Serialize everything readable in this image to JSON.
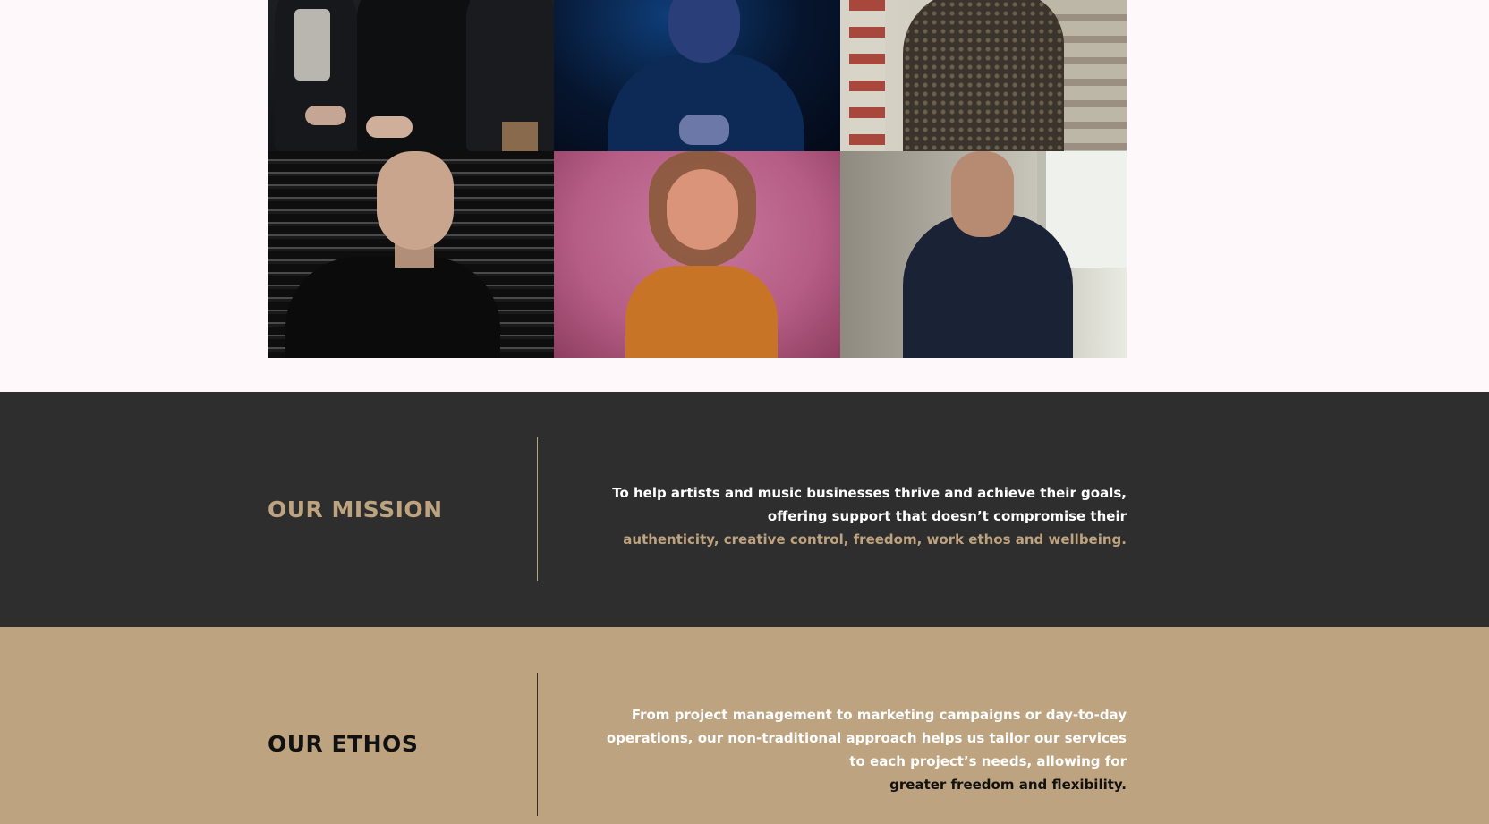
{
  "gallery": {
    "photos": [
      {
        "subject": "band-group"
      },
      {
        "subject": "man-blue-light"
      },
      {
        "subject": "person-building"
      },
      {
        "subject": "man-dark-backdrop"
      },
      {
        "subject": "woman-pink-backdrop"
      },
      {
        "subject": "man-by-window"
      }
    ]
  },
  "mission": {
    "heading": "OUR MISSION",
    "lines": [
      "To help artists and music businesses thrive and achieve their goals,",
      "offering support that doesn’t compromise their",
      "authenticity, creative control, freedom, work ethos and wellbeing."
    ]
  },
  "ethos": {
    "heading": "OUR ETHOS",
    "lines": [
      "From project management to marketing campaigns or day-to-day",
      "operations, our non-traditional approach helps us tailor our services",
      "to each project’s needs, allowing for",
      "greater freedom and flexibility."
    ]
  },
  "colors": {
    "page_bg": "#fff8fa",
    "dark_section": "#2e2e2e",
    "tan_section": "#bda37f",
    "accent_gold": "#bda37f",
    "text_white": "#ffffff",
    "text_black": "#111111"
  }
}
